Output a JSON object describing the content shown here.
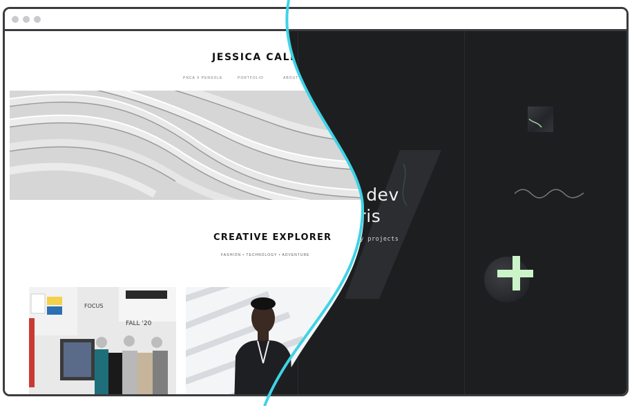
{
  "browser": {
    "dots": [
      "close",
      "minimize",
      "maximize"
    ]
  },
  "light_site": {
    "name": "JESSICA CALDWELL",
    "nav": [
      "PNCA X PENSOLE",
      "PORTFOLIO",
      "ABOUT"
    ],
    "tagline_title": "CREATIVE EXPLORER",
    "tagline_sub": "FASHION • TECHNOLOGY • ADVENTURE"
  },
  "dark_site": {
    "hero_line1": "ative dev",
    "hero_line2": "in Paris",
    "cta": "discover my projects",
    "accent_color": "#cbf5c9"
  },
  "divider_color": "#3fd3e6",
  "icons": [
    "plus-icon",
    "wave-icon"
  ]
}
